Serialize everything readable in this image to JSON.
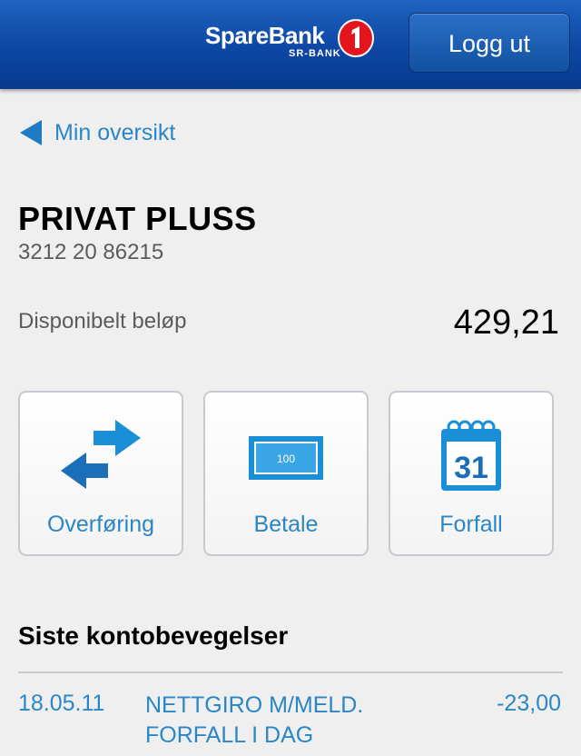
{
  "header": {
    "logo_text": "SpareBank",
    "logo_sub": "SR-BANK",
    "logout_label": "Logg ut"
  },
  "nav": {
    "back_label": "Min oversikt"
  },
  "account": {
    "name": "PRIVAT PLUSS",
    "number": "3212 20 86215",
    "available_label": "Disponibelt beløp",
    "available_value": "429,21"
  },
  "actions": [
    {
      "label": "Overføring",
      "icon": "transfer-arrows-icon"
    },
    {
      "label": "Betale",
      "icon": "banknote-icon",
      "icon_text": "100"
    },
    {
      "label": "Forfall",
      "icon": "calendar-icon",
      "icon_text": "31"
    }
  ],
  "transactions": {
    "title": "Siste kontobevegelser",
    "items": [
      {
        "date": "18.05.11",
        "description": "NETTGIRO M/MELD. FORFALL I DAG",
        "amount": "-23,00"
      }
    ]
  },
  "colors": {
    "header_blue": "#0d47a4",
    "link_blue": "#2b86c6",
    "icon_blue": "#1a8fd8",
    "logo_red": "#e2161c"
  }
}
